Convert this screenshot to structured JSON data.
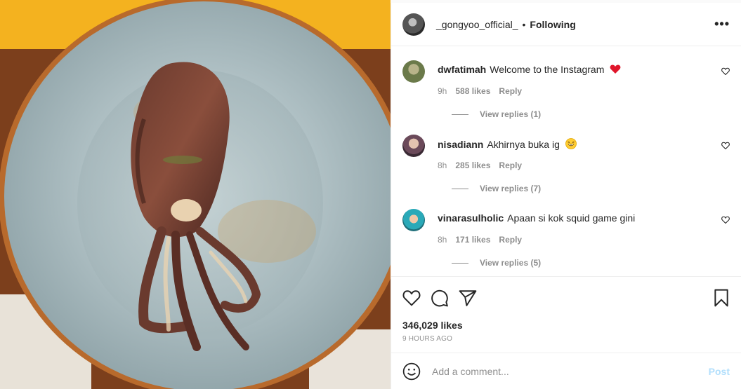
{
  "post": {
    "photo_icon": "grilled-squid-photo",
    "author": "_gongyoo_official_",
    "separator": "•",
    "follow_status": "Following",
    "more_icon": "ellipsis-icon",
    "more_label": "•••"
  },
  "comments": [
    {
      "username": "dwfatimah",
      "text": "Welcome to the Instagram",
      "emoji": "red-heart",
      "time": "9h",
      "likes": "588 likes",
      "reply": "Reply",
      "view_replies": "View replies (1)",
      "avatar_color": "#6b7a4a"
    },
    {
      "username": "nisadiann",
      "text": "Akhirnya buka ig",
      "emoji": "laughing-face",
      "time": "8h",
      "likes": "285 likes",
      "reply": "Reply",
      "view_replies": "View replies (7)",
      "avatar_color": "#8a6a7a"
    },
    {
      "username": "vinarasulholic",
      "text": "Apaan si kok squid game gini",
      "emoji": "",
      "time": "8h",
      "likes": "171 likes",
      "reply": "Reply",
      "view_replies": "View replies (5)",
      "avatar_color": "#2aa9b8"
    }
  ],
  "engagement": {
    "likes": "346,029 likes",
    "time_ago": "9 HOURS AGO"
  },
  "composer": {
    "placeholder": "Add a comment...",
    "post_label": "Post"
  },
  "colors": {
    "heart_red": "#ed4956",
    "text_secondary": "#8e8e8e",
    "post_disabled": "#b2dffc",
    "border": "#efefef"
  }
}
